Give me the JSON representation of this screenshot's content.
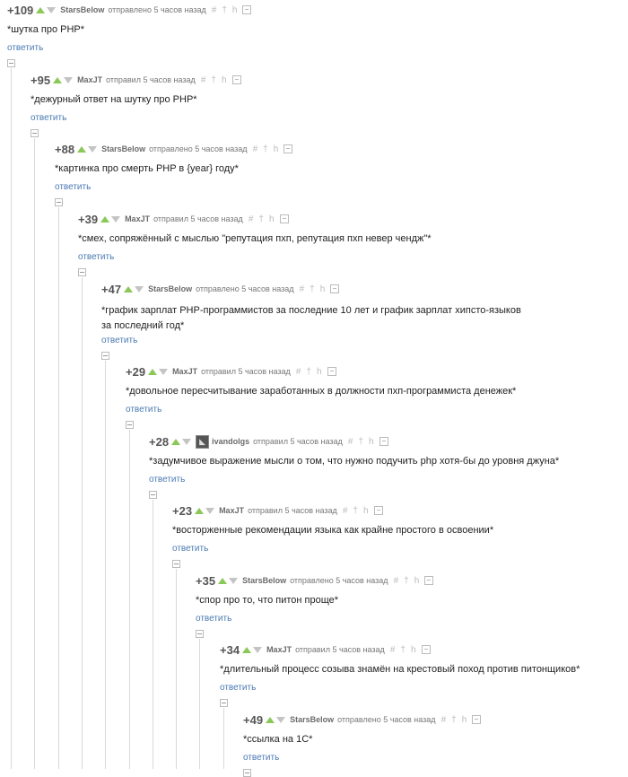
{
  "comments": [
    {
      "rating": "+109",
      "author": "StarsBelow",
      "action": "отправлено 5 часов назад",
      "text": "*шутка про PHP*",
      "reply": "ответить",
      "avatar": false
    },
    {
      "rating": "+95",
      "author": "MaxJT",
      "action": "отправил 5 часов назад",
      "text": "*дежурный ответ на шутку про PHP*",
      "reply": "ответить",
      "avatar": false
    },
    {
      "rating": "+88",
      "author": "StarsBelow",
      "action": "отправлено 5 часов назад",
      "text": "*картинка про смерть PHP в {year} году*",
      "reply": "ответить",
      "avatar": false
    },
    {
      "rating": "+39",
      "author": "MaxJT",
      "action": "отправил 5 часов назад",
      "text": "*смех, сопряжённый с мыслью \"репутация пхп, репутация пхп невер чендж\"*",
      "reply": "ответить",
      "avatar": false
    },
    {
      "rating": "+47",
      "author": "StarsBelow",
      "action": "отправлено 5 часов назад",
      "text": "*график зарплат PHP-программистов за последние 10 лет и график зарплат хипсто-языков за последний год*",
      "reply": "ответить",
      "avatar": false
    },
    {
      "rating": "+29",
      "author": "MaxJT",
      "action": "отправил 5 часов назад",
      "text": "*довольное пересчитывание заработанных в должности пхп-программиста денежек*",
      "reply": "ответить",
      "avatar": false
    },
    {
      "rating": "+28",
      "author": "ivandolgs",
      "action": "отправил 5 часов назад",
      "text": "*задумчивое выражение мысли о том, что нужно подучить php хотя-бы до уровня джуна*",
      "reply": "ответить",
      "avatar": true
    },
    {
      "rating": "+23",
      "author": "MaxJT",
      "action": "отправил 5 часов назад",
      "text": "*восторженные рекомендации языка как крайне простого в освоении*",
      "reply": "ответить",
      "avatar": false
    },
    {
      "rating": "+35",
      "author": "StarsBelow",
      "action": "отправлено 5 часов назад",
      "text": "*спор про то, что питон проще*",
      "reply": "ответить",
      "avatar": false
    },
    {
      "rating": "+34",
      "author": "MaxJT",
      "action": "отправил 5 часов назад",
      "text": "*длительный процесс созыва знамён на крестовый поход против питонщиков*",
      "reply": "ответить",
      "avatar": false
    },
    {
      "rating": "+49",
      "author": "StarsBelow",
      "action": "отправлено 5 часов назад",
      "text": "*ссылка на 1С*",
      "reply": "ответить",
      "avatar": false
    }
  ],
  "icons": {
    "hash": "#",
    "pin": "†",
    "branch": "h",
    "save": "save-icon",
    "up": "#8ac858",
    "down": "#c4c4c4"
  }
}
